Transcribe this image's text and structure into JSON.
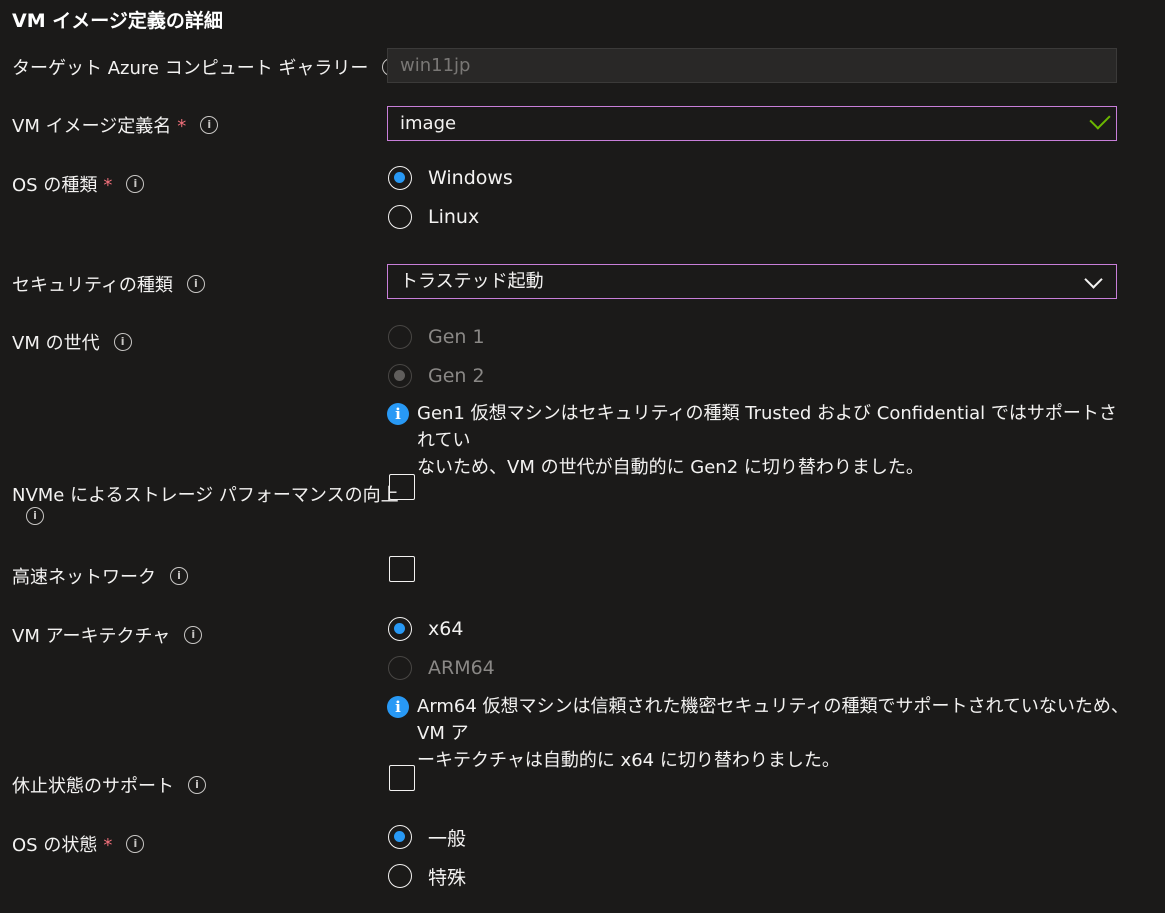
{
  "section_title": "VM イメージ定義の詳細",
  "target_gallery": {
    "label": "ターゲット Azure コンピュート ギャラリー",
    "value": "win11jp"
  },
  "image_def_name": {
    "label": "VM イメージ定義名",
    "required": "*",
    "value": "image"
  },
  "os_type": {
    "label": "OS の種類",
    "required": "*",
    "options": [
      "Windows",
      "Linux"
    ],
    "selected": "Windows"
  },
  "security_type": {
    "label": "セキュリティの種類",
    "value": "トラステッド起動"
  },
  "vm_generation": {
    "label": "VM の世代",
    "options": [
      "Gen 1",
      "Gen 2"
    ],
    "selected": "Gen 2",
    "message_line1": "Gen1 仮想マシンはセキュリティの種類 Trusted および Confidential ではサポートされてい",
    "message_line2": "ないため、VM の世代が自動的に Gen2 に切り替わりました。"
  },
  "nvme": {
    "label": "NVMe によるストレージ パフォーマンスの向上",
    "checked": false
  },
  "accel_network": {
    "label": "高速ネットワーク",
    "checked": false
  },
  "vm_architecture": {
    "label": "VM アーキテクチャ",
    "options": [
      "x64",
      "ARM64"
    ],
    "selected": "x64",
    "message_line1": "Arm64 仮想マシンは信頼された機密セキュリティの種類でサポートされていないため、VM ア",
    "message_line2": "ーキテクチャは自動的に x64 に切り替わりました。"
  },
  "hibernation": {
    "label": "休止状態のサポート",
    "checked": false
  },
  "os_state": {
    "label": "OS の状態",
    "required": "*",
    "options": [
      "一般",
      "特殊"
    ],
    "selected": "一般"
  },
  "icons": {
    "info": "i",
    "message_info": "i"
  },
  "colors": {
    "accent": "#2899f5",
    "required": "#f1707b",
    "valid": "#6bb700",
    "focus": "#c87fd9"
  }
}
